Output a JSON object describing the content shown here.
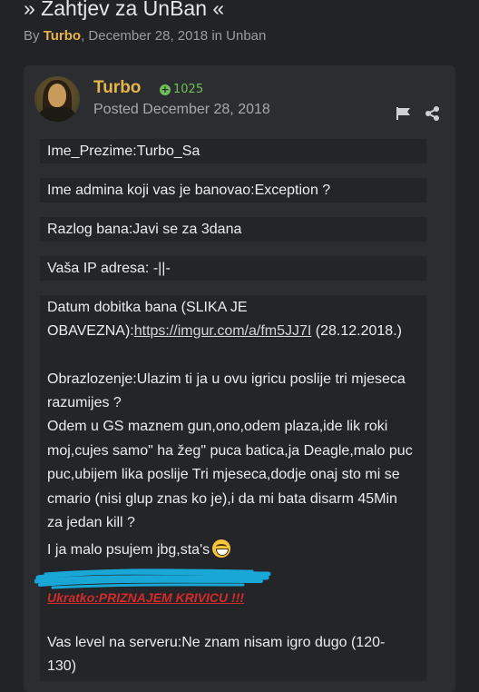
{
  "topic": {
    "title": "» Zahtjev za UnBan «",
    "by_label": "By",
    "author": "Turbo",
    "meta_rest": ", December 28, 2018 in Unban"
  },
  "post": {
    "username": "Turbo",
    "reputation": "1025",
    "posted": "Posted December 28, 2018",
    "lines": [
      "Ime_Prezime:Turbo_Sa",
      "Ime admina koji vas je banovao:Exception ?",
      "Razlog bana:Javi se za 3dana",
      "Vaša IP adresa: -||-",
      "Datum dobitka bana (SLIKA JE",
      "OBAVEZNA):",
      "https://imgur.com/a/fm5JJ7I",
      " (28.12.2018.)",
      "Obrazlozenje:Ulazim ti ja u ovu igricu poslije tri mjeseca",
      "razumijes ?",
      "Odem u GS maznem gun,ono,odem plaza,ide lik roki",
      "moj,cujes samo\" ha žeg\" puca batica,ja Deagle,malo puc",
      "puc,ubijem lika poslije Tri mjeseca,dodje onaj sto mi se",
      "cmario  (nisi glup znas ko je),i da mi bata disarm 45Min",
      "za jedan kill ?",
      "I ja malo psujem jbg,sta's",
      "Ukratko:PRIZNAJEM KRIVICU !!!",
      "Vas level na serveru:Ne znam nisam igro dugo (120-",
      "130)"
    ]
  },
  "colors": {
    "accent": "#e8b54a",
    "reputation": "#6fbf58",
    "scribble": "#18a7d6",
    "warning": "#d42a2a"
  },
  "icons": [
    "flag-icon",
    "share-icon",
    "plus-icon",
    "grin-emoji-icon"
  ]
}
